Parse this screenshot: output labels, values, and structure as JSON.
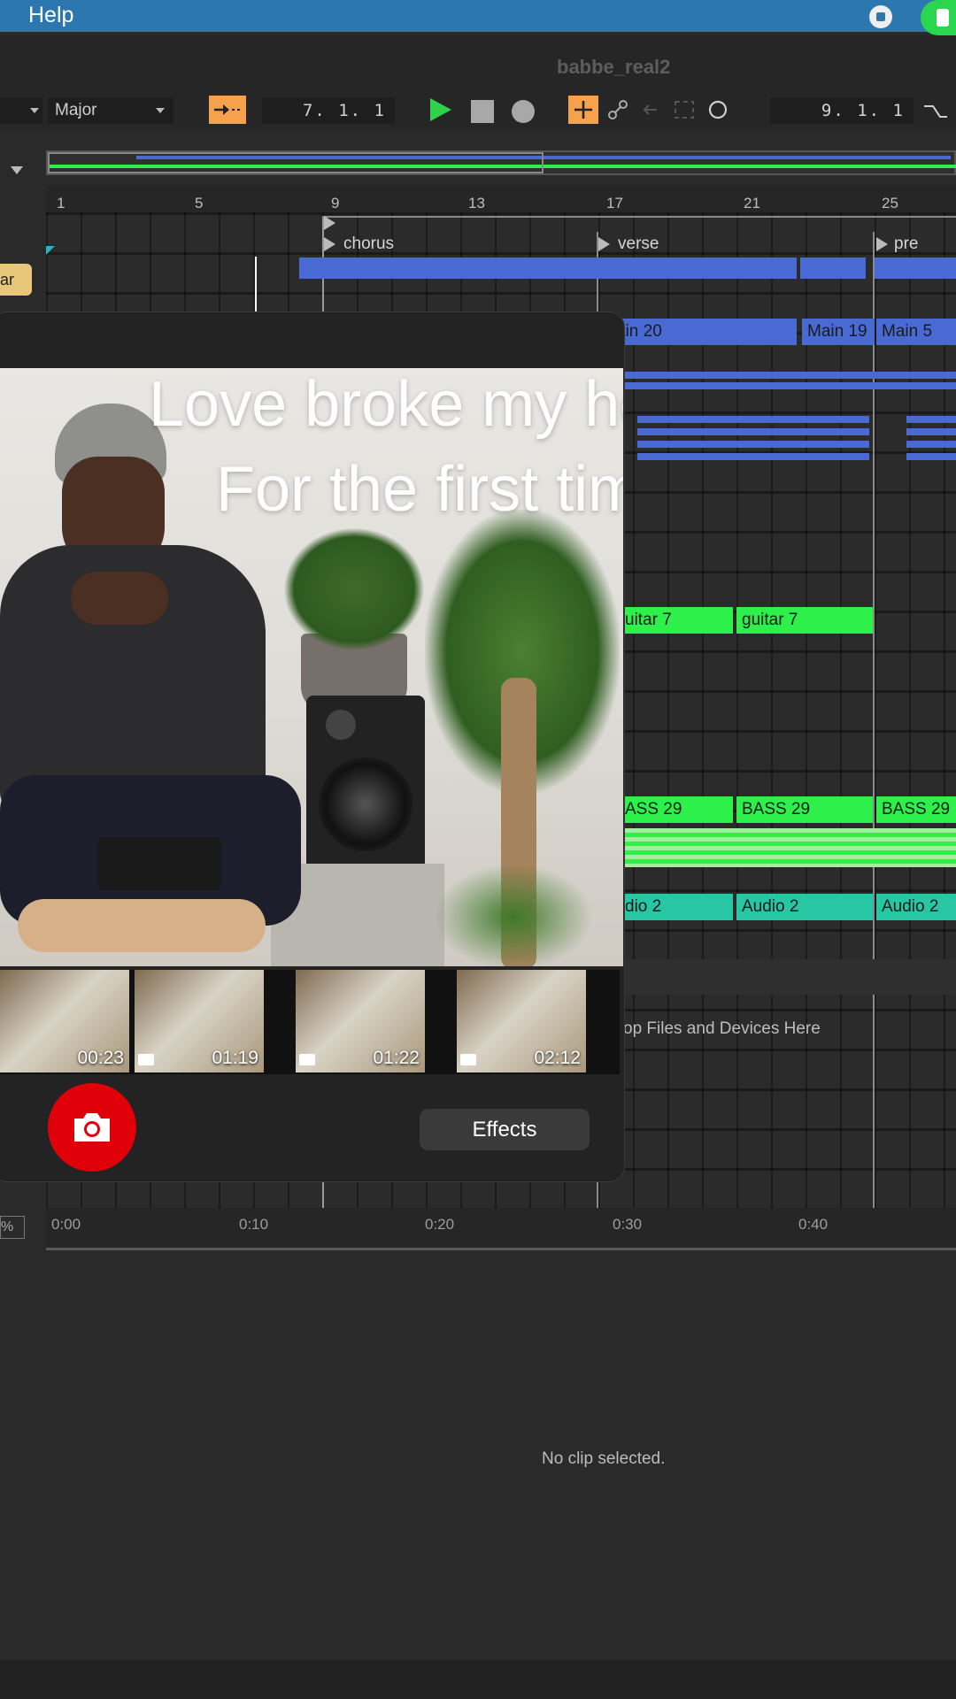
{
  "menubar": {
    "help_label": "Help"
  },
  "window": {
    "title": "babbe_real2"
  },
  "transport": {
    "key_value": "Major",
    "arrangement_position": "7. 1. 1",
    "loop_length": "9. 1. 1"
  },
  "ruler": {
    "bars": [
      "1",
      "5",
      "9",
      "13",
      "17",
      "21",
      "25"
    ]
  },
  "locators": [
    "chorus",
    "verse",
    "pre"
  ],
  "tracks": {
    "track_tag": "ar",
    "main_clips": [
      "ain 20",
      "Main 19",
      "Main 5"
    ],
    "guitar_clips": [
      "uitar 7",
      "guitar 7"
    ],
    "bass_clips": [
      "ASS 29",
      "BASS 29",
      "BASS 29"
    ],
    "audio_clips": [
      "dio 2",
      "Audio 2",
      "Audio 2"
    ],
    "drop_hint": "op Files and Devices Here"
  },
  "time_ruler": [
    "0:00",
    "0:10",
    "0:20",
    "0:30",
    "0:40"
  ],
  "zoom_tag": "%",
  "detail": {
    "empty_text": "No clip selected."
  },
  "camera_panel": {
    "caption_line1": "Love broke my heart",
    "caption_line2": "For the first time",
    "thumbnails": [
      "00:23",
      "01:19",
      "01:22",
      "02:12"
    ],
    "effects_label": "Effects"
  },
  "colors": {
    "menubar": "#2d77b1",
    "midi_clip": "#4a6ad3",
    "guitar_clip": "#2ef04a",
    "audio_clip": "#27c7a4",
    "transport_accent": "#f6a14b",
    "shutter": "#e00009"
  }
}
